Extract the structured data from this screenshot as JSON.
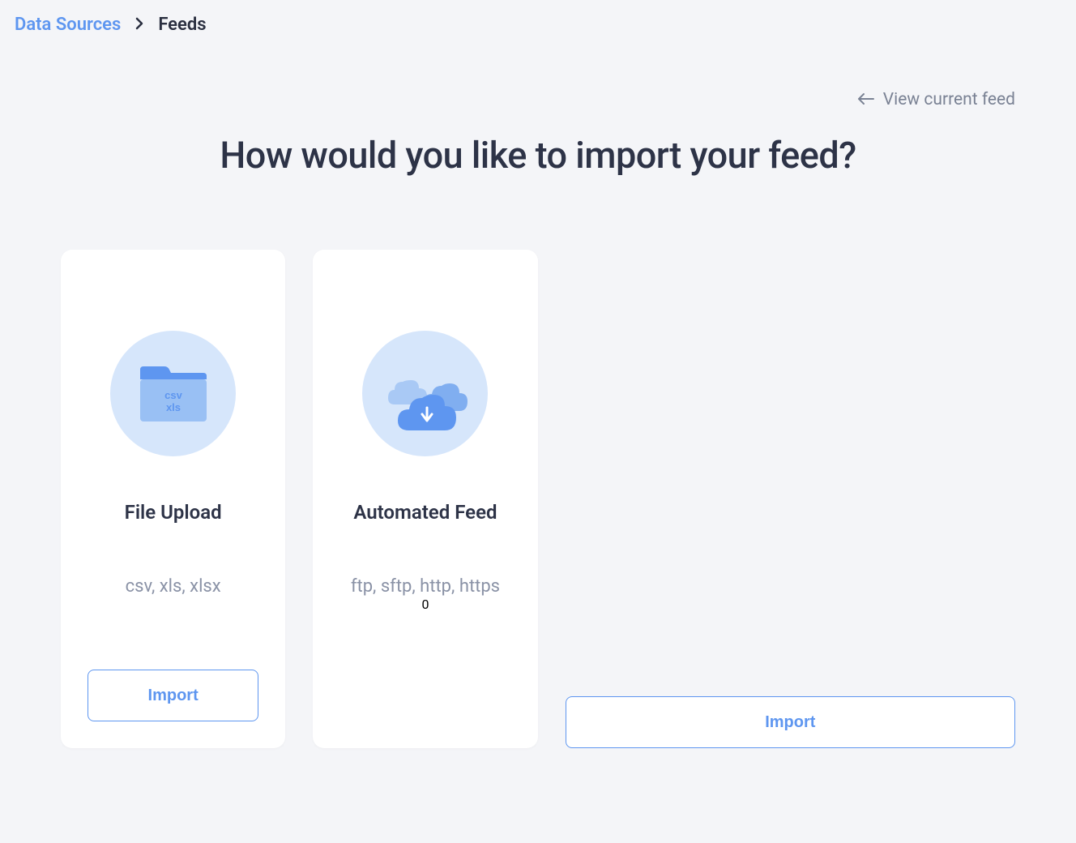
{
  "breadcrumb": {
    "link_label": "Data Sources",
    "current_label": "Feeds"
  },
  "header": {
    "view_link_label": "View current feed"
  },
  "page_title": "How would you like to import your feed?",
  "cards": [
    {
      "title": "File Upload",
      "subtitle": "csv, xls, xlsx",
      "button_label": "Import",
      "folder_label_line1": "csv",
      "folder_label_line2": "xls"
    },
    {
      "title": "Automated Feed",
      "subtitle": "ftp, sftp, http, https",
      "button_label": "Import"
    }
  ]
}
